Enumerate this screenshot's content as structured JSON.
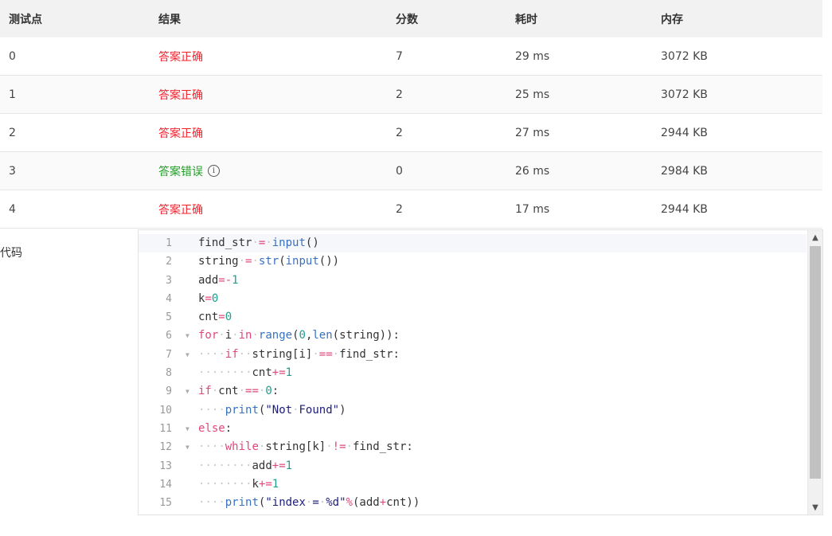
{
  "table": {
    "headers": [
      "测试点",
      "结果",
      "分数",
      "耗时",
      "内存"
    ],
    "rows": [
      {
        "id": "0",
        "result": "答案正确",
        "status": "ok",
        "score": "7",
        "time": "29 ms",
        "memory": "3072 KB"
      },
      {
        "id": "1",
        "result": "答案正确",
        "status": "ok",
        "score": "2",
        "time": "25 ms",
        "memory": "3072 KB"
      },
      {
        "id": "2",
        "result": "答案正确",
        "status": "ok",
        "score": "2",
        "time": "27 ms",
        "memory": "2944 KB"
      },
      {
        "id": "3",
        "result": "答案错误",
        "status": "wrong",
        "score": "0",
        "time": "26 ms",
        "memory": "2984 KB"
      },
      {
        "id": "4",
        "result": "答案正确",
        "status": "ok",
        "score": "2",
        "time": "17 ms",
        "memory": "2944 KB"
      }
    ],
    "info_icon_glyph": "i"
  },
  "code_section": {
    "label": "代码",
    "line_numbers": [
      "1",
      "2",
      "3",
      "4",
      "5",
      "6",
      "7",
      "8",
      "9",
      "10",
      "11",
      "12",
      "13",
      "14",
      "15"
    ],
    "lines": [
      "find_str = input()",
      "string = str(input())",
      "add=-1",
      "k=0",
      "cnt=0",
      "for i in range(0,len(string)):",
      "    if  string[i] == find_str:",
      "        cnt+=1",
      "if cnt == 0:",
      "    print(\"Not Found\")",
      "else:",
      "    while string[k] != find_str:",
      "        add+=1",
      "        k+=1",
      "    print(\"index = %d\"%(add+cnt))"
    ],
    "fold_markers": [
      "6",
      "7",
      "9",
      "11",
      "12"
    ]
  },
  "colors": {
    "correct": "#f5222d",
    "wrong": "#21a026",
    "keyword": "#e2477a",
    "builtin": "#3a72c2",
    "number": "#1f9e8c"
  }
}
